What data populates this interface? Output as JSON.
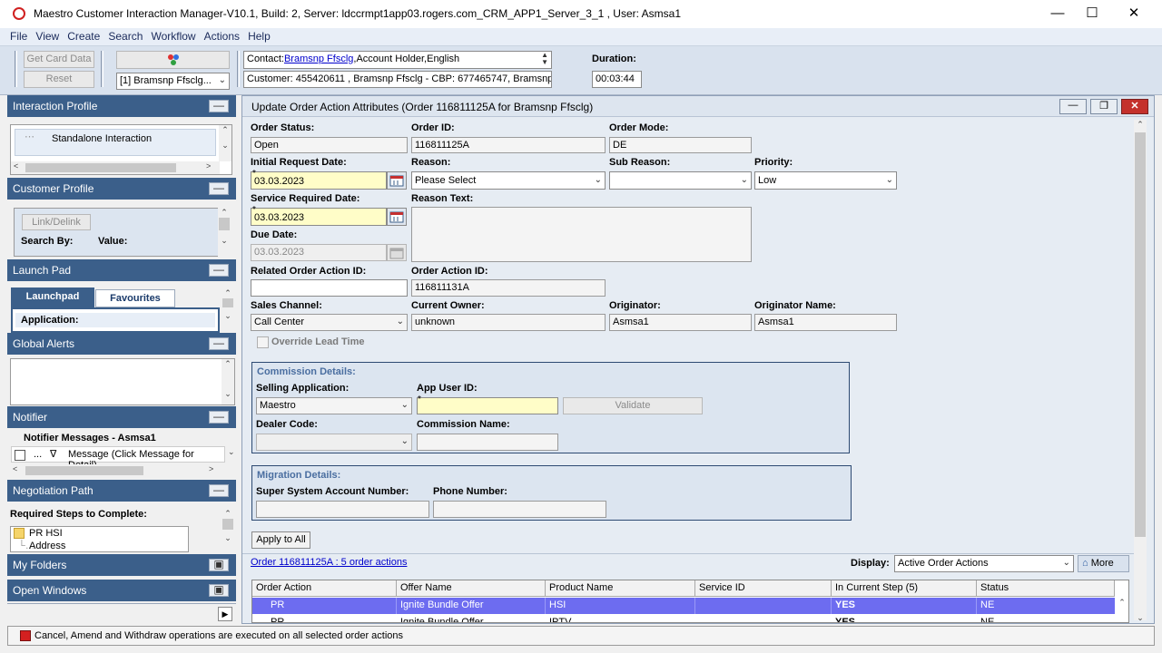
{
  "window": {
    "title": "Maestro Customer Interaction Manager-V10.1, Build: 2, Server: ldccrmpt1app03.rogers.com_CRM_APP1_Server_3_1 , User: Asmsa1",
    "minimize": "—",
    "maximize": "☐",
    "close": "✕"
  },
  "menu": [
    "File",
    "View",
    "Create",
    "Search",
    "Workflow",
    "Actions",
    "Help"
  ],
  "toolbar": {
    "get_card_data": "Get Card Data",
    "reset": "Reset",
    "customer_combo": "[1] Bramsnp Ffsclg...",
    "contact_prefix": "Contact:",
    "contact_name": "Bramsnp Ffsclg",
    "contact_suffix": ",Account Holder,English",
    "customer_line": "Customer: 455420611 , Bramsnp Ffsclg - CBP: 677465747, Bramsnp F",
    "duration_label": "Duration:",
    "duration_value": "00:03:44"
  },
  "left_panel": {
    "interaction_profile": {
      "header": "Interaction Profile",
      "item": "Standalone Interaction"
    },
    "customer_profile": {
      "header": "Customer Profile",
      "link_delink": "Link/Delink",
      "search_by": "Search By:",
      "value": "Value:"
    },
    "launch_pad": {
      "header": "Launch Pad",
      "tab_launchpad": "Launchpad",
      "tab_favourites": "Favourites",
      "application_label": "Application:"
    },
    "global_alerts": {
      "header": "Global Alerts"
    },
    "notifier": {
      "header": "Notifier",
      "messages_title": "Notifier Messages - Asmsa1",
      "col_dots": "...",
      "col_flag": "∇",
      "col_message": "Message (Click Message for Detail)"
    },
    "negotiation_path": {
      "header": "Negotiation Path",
      "required_steps": "Required Steps to Complete:",
      "step1": "PR HSI",
      "step2": "Address"
    },
    "my_folders": {
      "header": "My Folders"
    },
    "open_windows": {
      "header": "Open Windows"
    }
  },
  "form": {
    "title": "Update Order Action Attributes (Order 116811125A for Bramsnp Ffsclg)",
    "order_status": {
      "label": "Order Status:",
      "value": "Open"
    },
    "order_id": {
      "label": "Order ID:",
      "value": "116811125A"
    },
    "order_mode": {
      "label": "Order Mode:",
      "value": "DE"
    },
    "initial_request_date": {
      "label": "Initial Request Date:",
      "value": "03.03.2023"
    },
    "reason": {
      "label": "Reason:",
      "value": "Please Select"
    },
    "sub_reason": {
      "label": "Sub Reason:",
      "value": ""
    },
    "priority": {
      "label": "Priority:",
      "value": "Low"
    },
    "service_required_date": {
      "label": "Service Required Date:",
      "value": "03.03.2023"
    },
    "reason_text": {
      "label": "Reason Text:",
      "value": ""
    },
    "due_date": {
      "label": "Due Date:",
      "value": "03.03.2023"
    },
    "related_order_action_id": {
      "label": "Related Order Action ID:",
      "value": ""
    },
    "order_action_id": {
      "label": "Order Action ID:",
      "value": "116811131A"
    },
    "sales_channel": {
      "label": "Sales Channel:",
      "value": "Call Center"
    },
    "current_owner": {
      "label": "Current Owner:",
      "value": "unknown"
    },
    "originator": {
      "label": "Originator:",
      "value": "Asmsa1"
    },
    "originator_name": {
      "label": "Originator Name:",
      "value": "Asmsa1"
    },
    "override_lead_time": "Override Lead Time",
    "commission": {
      "title": "Commission Details:",
      "selling_application": {
        "label": "Selling Application:",
        "value": "Maestro"
      },
      "app_user_id": {
        "label": "App User ID:",
        "value": ""
      },
      "validate": "Validate",
      "dealer_code": {
        "label": "Dealer Code:",
        "value": ""
      },
      "commission_name": {
        "label": "Commission Name:",
        "value": ""
      }
    },
    "migration": {
      "title": "Migration Details:",
      "super_system_account": {
        "label": "Super System Account Number:",
        "value": ""
      },
      "phone_number": {
        "label": "Phone Number:",
        "value": ""
      }
    },
    "apply_to_all": "Apply to All",
    "order_link": "Order 116811125A : 5 order actions",
    "display_label": "Display:",
    "display_value": "Active Order Actions",
    "more": "More",
    "table": {
      "columns": [
        "Order Action",
        "Offer Name",
        "Product Name",
        "Service ID",
        "In Current Step (5)",
        "Status"
      ],
      "rows": [
        [
          "PR",
          "Ignite Bundle Offer",
          "HSI",
          "",
          "YES",
          "NE"
        ],
        [
          "PR",
          "Ignite Bundle Offer",
          "IPTV",
          "",
          "YES",
          "NE"
        ]
      ]
    }
  },
  "status_bar": "Cancel, Amend and Withdraw operations are executed on all selected order actions",
  "colors": {
    "panel_header": "#3b5f8a",
    "selected_row": "#6d6cf0",
    "required_field": "#fffdc8"
  }
}
